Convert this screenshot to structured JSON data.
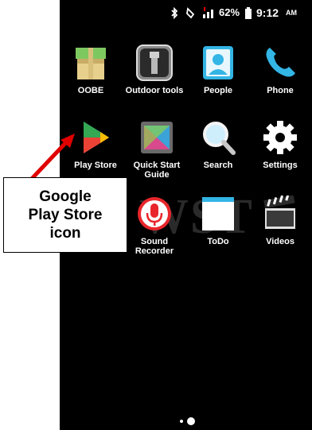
{
  "statusbar": {
    "battery_percent": "62%",
    "time": "9:12",
    "ampm": "AM"
  },
  "apps": [
    {
      "label": "OOBE"
    },
    {
      "label": "Outdoor tools"
    },
    {
      "label": "People"
    },
    {
      "label": "Phone"
    },
    {
      "label": "Play Store"
    },
    {
      "label": "Quick Start Guide"
    },
    {
      "label": "Search"
    },
    {
      "label": "Settings"
    },
    {
      "label": "Sound Recorder"
    },
    {
      "label": "ToDo"
    },
    {
      "label": "Videos"
    }
  ],
  "callout": {
    "line1": "Google",
    "line2": "Play Store",
    "line3": "icon"
  },
  "watermark": "WST",
  "colors": {
    "background": "#000000",
    "arrow": "#e00000"
  }
}
